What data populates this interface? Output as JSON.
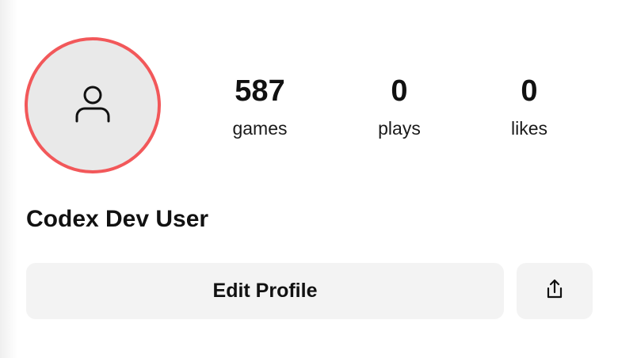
{
  "profile": {
    "avatar_icon": "user-icon",
    "display_name": "Codex Dev User",
    "stats": [
      {
        "value": "587",
        "label": "games"
      },
      {
        "value": "0",
        "label": "plays"
      },
      {
        "value": "0",
        "label": "likes"
      }
    ],
    "actions": {
      "edit_label": "Edit Profile",
      "share_icon": "share-icon"
    }
  },
  "colors": {
    "avatar_ring": "#f2585a",
    "avatar_fill": "#e9e9e9",
    "button_bg": "#f3f3f3",
    "text": "#111111"
  }
}
